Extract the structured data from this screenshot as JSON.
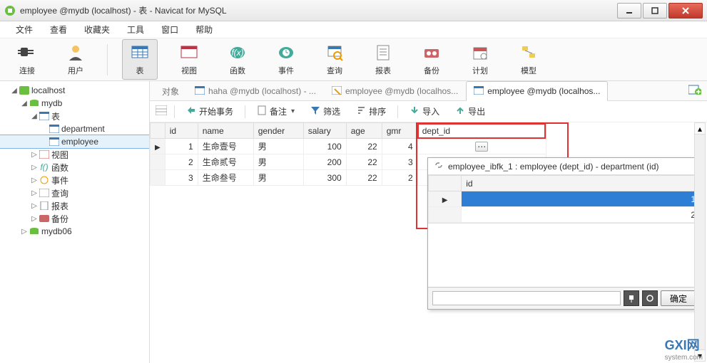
{
  "titlebar": {
    "title": "employee @mydb (localhost) - 表 - Navicat for MySQL"
  },
  "menu": {
    "file": "文件",
    "view": "查看",
    "favorites": "收藏夹",
    "tools": "工具",
    "window": "窗口",
    "help": "帮助"
  },
  "toolbar": {
    "connection": "连接",
    "user": "用户",
    "table": "表",
    "view": "视图",
    "function": "函数",
    "event": "事件",
    "query": "查询",
    "report": "报表",
    "backup": "备份",
    "schedule": "计划",
    "model": "模型"
  },
  "tree": {
    "host": "localhost",
    "db1": "mydb",
    "tables_label": "表",
    "table_department": "department",
    "table_employee": "employee",
    "views": "视图",
    "functions": "函数",
    "events": "事件",
    "queries": "查询",
    "reports": "报表",
    "backups": "备份",
    "db2": "mydb06"
  },
  "tabs": {
    "objects": "对象",
    "t1": "haha @mydb (localhost) - ...",
    "t2": "employee @mydb (localhos...",
    "t3": "employee @mydb (localhos..."
  },
  "actions": {
    "begin_tx": "开始事务",
    "memo": "备注",
    "filter": "筛选",
    "sort": "排序",
    "import": "导入",
    "export": "导出"
  },
  "table": {
    "columns": [
      "id",
      "name",
      "gender",
      "salary",
      "age",
      "gmr",
      "dept_id"
    ],
    "rows": [
      {
        "id": "1",
        "name": "生命壹号",
        "gender": "男",
        "salary": "100",
        "age": "22",
        "gmr": "4"
      },
      {
        "id": "2",
        "name": "生命贰号",
        "gender": "男",
        "salary": "200",
        "age": "22",
        "gmr": "3"
      },
      {
        "id": "3",
        "name": "生命叁号",
        "gender": "男",
        "salary": "300",
        "age": "22",
        "gmr": "2"
      }
    ]
  },
  "fk_popup": {
    "title": "employee_ibfk_1 : employee (dept_id) - department (id)",
    "col": "id",
    "rows": [
      "1",
      "2"
    ],
    "ok": "确定"
  },
  "watermark": {
    "main": "GXI网",
    "sub": "system.com"
  },
  "colors": {
    "accent": "#2e7ed6",
    "danger": "#d33"
  }
}
